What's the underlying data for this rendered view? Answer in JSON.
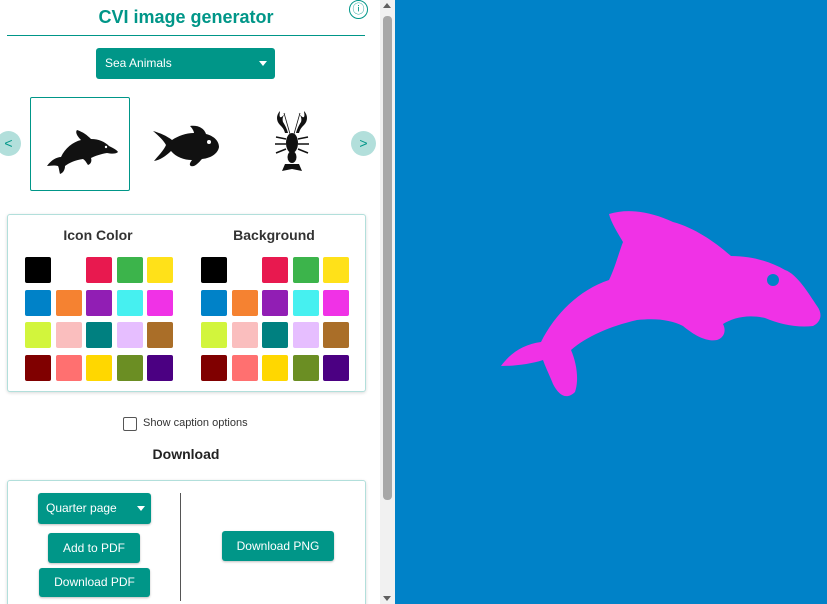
{
  "app": {
    "title": "CVI image generator",
    "info_symbol": "ⓘ"
  },
  "category_select": {
    "value": "Sea Animals"
  },
  "carousel": {
    "prev_label": "<",
    "next_label": ">",
    "items": [
      {
        "icon": "dolphin-icon",
        "selected": true
      },
      {
        "icon": "fish-icon",
        "selected": false
      },
      {
        "icon": "lobster-icon",
        "selected": false
      }
    ]
  },
  "colors": {
    "icon_heading": "Icon Color",
    "background_heading": "Background",
    "palette": [
      "#000000",
      "#ffffff",
      "#e8194f",
      "#3cb44b",
      "#ffe119",
      "#0082c8",
      "#f58231",
      "#911eb4",
      "#46f0f0",
      "#f032e6",
      "#d2f53c",
      "#fabebe",
      "#008080",
      "#e6beff",
      "#aa6e28",
      "#800000",
      "#ff7070",
      "#ffd700",
      "#6b8e23",
      "#4b0082"
    ],
    "selected_icon_color": "#f032e6",
    "selected_background_color": "#0082c8"
  },
  "caption": {
    "label": "Show caption options",
    "checked": false
  },
  "download": {
    "heading": "Download",
    "page_size_value": "Quarter page",
    "add_pdf_label": "Add to PDF",
    "download_pdf_label": "Download PDF",
    "download_png_label": "Download PNG"
  },
  "theme": {
    "accent": "#009688",
    "accent_light": "#b2dfdb"
  }
}
